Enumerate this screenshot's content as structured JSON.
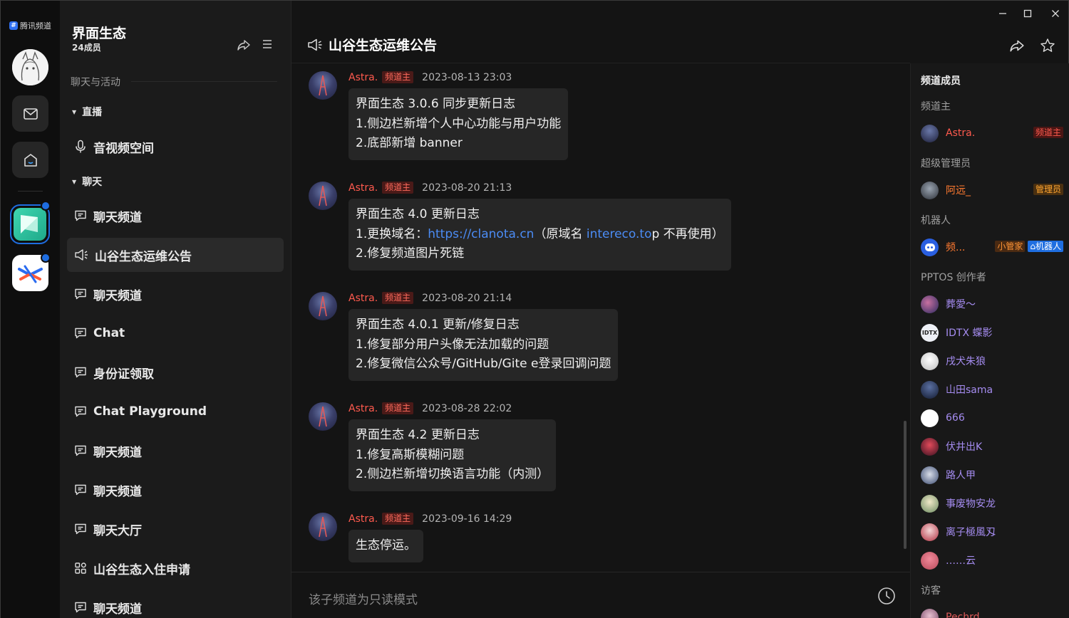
{
  "app": {
    "brand": "腾讯频道",
    "brand_mark": "#"
  },
  "guild": {
    "name": "界面生态",
    "members": "24成员"
  },
  "sidebar": {
    "section_label": "聊天与活动",
    "groups": [
      {
        "label": "直播"
      },
      {
        "label": "聊天"
      }
    ],
    "channels": [
      {
        "label": "音视频空间",
        "icon": "microphone-icon"
      },
      {
        "label": "聊天频道",
        "icon": "chat-bubble-icon"
      },
      {
        "label": "山谷生态运维公告",
        "icon": "speaker-icon"
      },
      {
        "label": "聊天频道",
        "icon": "chat-bubble-icon"
      },
      {
        "label": "Chat",
        "icon": "chat-bubble-icon"
      },
      {
        "label": "身份证领取",
        "icon": "chat-bubble-icon"
      },
      {
        "label": "Chat Playground",
        "icon": "chat-bubble-icon"
      },
      {
        "label": "聊天频道",
        "icon": "chat-bubble-icon"
      },
      {
        "label": "聊天频道",
        "icon": "chat-bubble-icon"
      },
      {
        "label": "聊天大厅",
        "icon": "chat-bubble-icon"
      },
      {
        "label": "山谷生态入住申请",
        "icon": "app-grid-icon"
      },
      {
        "label": "聊天频道",
        "icon": "chat-bubble-icon"
      }
    ]
  },
  "channel": {
    "title": "山谷生态运维公告"
  },
  "messages": [
    {
      "author": "Astra.",
      "badge": "频道主",
      "time": "2023-08-13 23:03",
      "lines": [
        "界面生态 3.0.6 同步更新日志",
        "1.侧边栏新增个人中心功能与用户功能",
        "2.底部新增 banner"
      ]
    },
    {
      "author": "Astra.",
      "badge": "频道主",
      "time": "2023-08-20 21:13",
      "lines": [
        "界面生态 4.0 更新日志"
      ],
      "domain_line": {
        "prefix": "1.更换域名：",
        "link1": "https://clanota.cn",
        "middle": "（原域名 ",
        "link2": "intereco.to",
        "suffix": "p 不再使用）"
      },
      "last_line": "2.修复频道图片死链"
    },
    {
      "author": "Astra.",
      "badge": "频道主",
      "time": "2023-08-20 21:14",
      "lines": [
        "界面生态 4.0.1 更新/修复日志",
        "1.修复部分用户头像无法加载的问题",
        "2.修复微信公众号/GitHub/Gite e登录回调问题"
      ]
    },
    {
      "author": "Astra.",
      "badge": "频道主",
      "time": "2023-08-28 22:02",
      "lines": [
        "界面生态 4.2 更新日志",
        "1.修复高斯模糊问题",
        "2.侧边栏新增切换语言功能（内测）"
      ]
    },
    {
      "author": "Astra.",
      "badge": "频道主",
      "time": "2023-09-16 14:29",
      "lines": [
        "生态停运。"
      ]
    }
  ],
  "composer": {
    "placeholder": "该子频道为只读模式"
  },
  "members": {
    "title": "频道成员",
    "roles": {
      "owner": "频道主",
      "super_admin": "超级管理员",
      "bot": "机器人",
      "creator": "PPTOS 创作者",
      "visitor": "访客"
    },
    "owner": {
      "name": "Astra.",
      "tag": "频道主"
    },
    "admin": {
      "name": "阿远_",
      "tag": "管理员"
    },
    "bot": {
      "name": "频...",
      "tag1": "小管家",
      "tag2": "机器人"
    },
    "creators": [
      "葬愛～",
      "IDTX 蝶影",
      "戌犬朱狼",
      "山田sama",
      "666",
      "伏井出K",
      "路人甲",
      "事废物安龙",
      "离子極風刄",
      "……云"
    ],
    "visitors": [
      "Pechrd"
    ]
  },
  "colors": {
    "accent": "#1e6de0",
    "owner_red": "#ff5a4e",
    "link": "#4b8cf5",
    "member_purple": "#a58cf0"
  }
}
